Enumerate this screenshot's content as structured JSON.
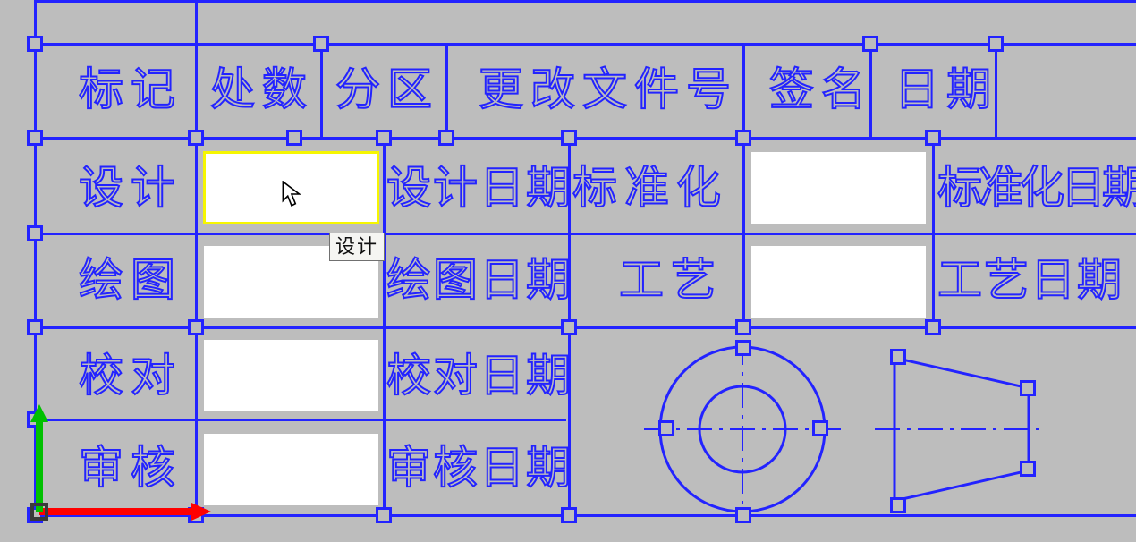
{
  "header": {
    "c1": "标记",
    "c2": "处数",
    "c3": "分区",
    "c4": "更改文件号",
    "c5": "签名",
    "c6": "日期"
  },
  "rows": {
    "r1": {
      "label": "设计",
      "date": "设计日期",
      "right_label": "标准化",
      "right_date": "标准化日期"
    },
    "r2": {
      "label": "绘图",
      "date": "绘图日期",
      "right_label": "工艺",
      "right_date": "工艺日期"
    },
    "r3": {
      "label": "校对",
      "date": "校对日期"
    },
    "r4": {
      "label": "审核",
      "date": "审核日期"
    }
  },
  "tooltip": "设计",
  "colors": {
    "line": "#2323ff",
    "bg": "#bdbdbd",
    "field": "#ffffff",
    "highlight": "#f6f600",
    "x_axis": "#ff0000",
    "y_axis": "#00d000"
  }
}
